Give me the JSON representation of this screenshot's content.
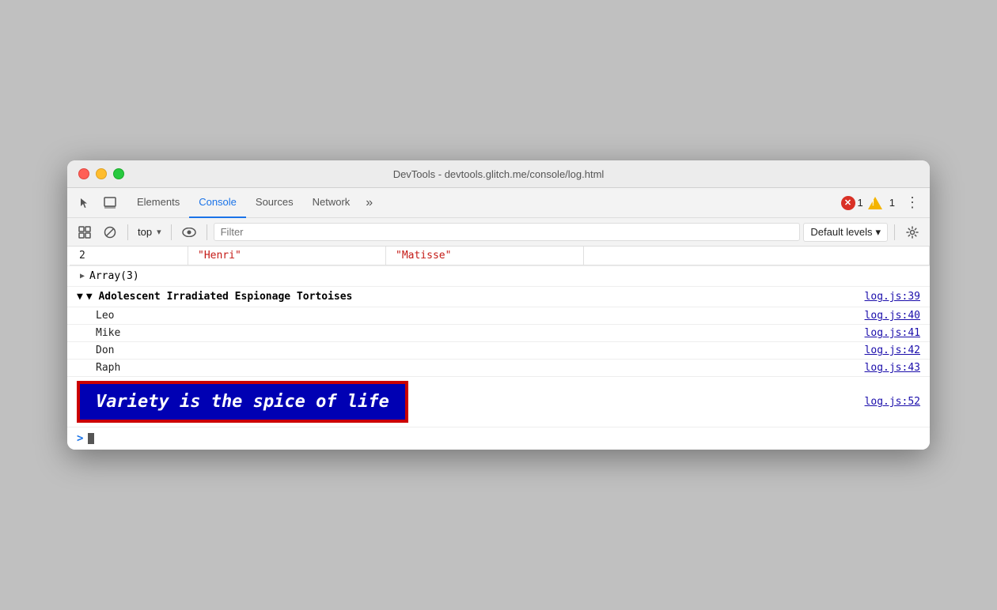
{
  "window": {
    "title": "DevTools - devtools.glitch.me/console/log.html"
  },
  "tabs": {
    "items": [
      {
        "id": "elements",
        "label": "Elements"
      },
      {
        "id": "console",
        "label": "Console",
        "active": true
      },
      {
        "id": "sources",
        "label": "Sources"
      },
      {
        "id": "network",
        "label": "Network"
      }
    ],
    "more_label": "»",
    "error_count": "1",
    "warn_count": "1"
  },
  "toolbar": {
    "context_value": "top",
    "filter_placeholder": "Filter",
    "levels_label": "Default levels",
    "levels_arrow": "▾"
  },
  "console": {
    "table_row": {
      "index": "2",
      "col1": "\"Henri\"",
      "col2": "\"Matisse\""
    },
    "array_label": "▶ Array(3)",
    "group_label": "▼ Adolescent Irradiated Espionage Tortoises",
    "group_link": "log.js:39",
    "log_items": [
      {
        "text": "Leo",
        "link": "log.js:40"
      },
      {
        "text": "Mike",
        "link": "log.js:41"
      },
      {
        "text": "Don",
        "link": "log.js:42"
      },
      {
        "text": "Raph",
        "link": "log.js:43"
      }
    ],
    "styled_text": "Variety is the spice of life",
    "styled_link": "log.js:52",
    "prompt_symbol": ">"
  },
  "colors": {
    "active_tab": "#1a73e8",
    "error_badge": "#d93025",
    "warn_badge": "#f4b400",
    "string_color": "#c41a16",
    "link_color": "#1a0dab",
    "styled_bg": "#0000b3",
    "styled_border": "#cc0000",
    "styled_text": "#ffffff"
  }
}
